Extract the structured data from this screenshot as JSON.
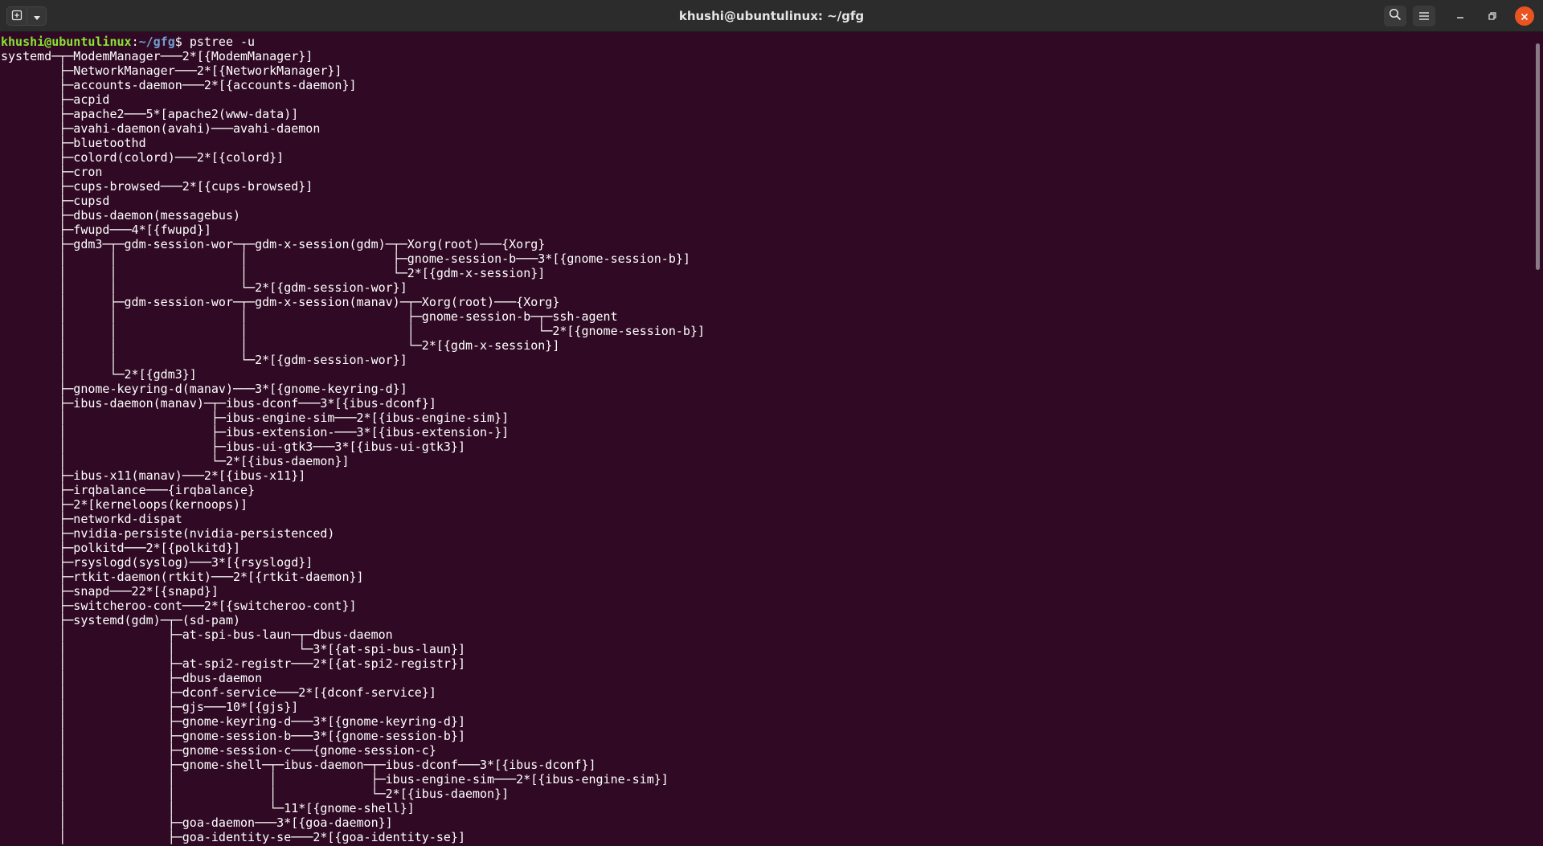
{
  "window": {
    "title": "khushi@ubuntulinux: ~/gfg"
  },
  "icons": {
    "new_tab": "new-tab-icon",
    "tab_menu": "chevron-down-icon",
    "search": "search-icon",
    "menu": "hamburger-menu-icon",
    "minimize": "minimize-icon",
    "maximize": "restore-icon",
    "close": "close-icon"
  },
  "colors": {
    "terminal_bg": "#300a24",
    "prompt_user": "#8ae234",
    "prompt_path": "#729fcf",
    "close_button": "#e95420"
  },
  "terminal": {
    "prompt_user": "khushi@ubuntulinux",
    "prompt_sep": ":",
    "prompt_path": "~/gfg",
    "prompt_end": "$ ",
    "command": "pstree -u",
    "output": "systemd─┬─ModemManager───2*[{ModemManager}]\n        ├─NetworkManager───2*[{NetworkManager}]\n        ├─accounts-daemon───2*[{accounts-daemon}]\n        ├─acpid\n        ├─apache2───5*[apache2(www-data)]\n        ├─avahi-daemon(avahi)───avahi-daemon\n        ├─bluetoothd\n        ├─colord(colord)───2*[{colord}]\n        ├─cron\n        ├─cups-browsed───2*[{cups-browsed}]\n        ├─cupsd\n        ├─dbus-daemon(messagebus)\n        ├─fwupd───4*[{fwupd}]\n        ├─gdm3─┬─gdm-session-wor─┬─gdm-x-session(gdm)─┬─Xorg(root)───{Xorg}\n        │      │                 │                    ├─gnome-session-b───3*[{gnome-session-b}]\n        │      │                 │                    └─2*[{gdm-x-session}]\n        │      │                 └─2*[{gdm-session-wor}]\n        │      ├─gdm-session-wor─┬─gdm-x-session(manav)─┬─Xorg(root)───{Xorg}\n        │      │                 │                      ├─gnome-session-b─┬─ssh-agent\n        │      │                 │                      │                 └─2*[{gnome-session-b}]\n        │      │                 │                      └─2*[{gdm-x-session}]\n        │      │                 └─2*[{gdm-session-wor}]\n        │      └─2*[{gdm3}]\n        ├─gnome-keyring-d(manav)───3*[{gnome-keyring-d}]\n        ├─ibus-daemon(manav)─┬─ibus-dconf───3*[{ibus-dconf}]\n        │                    ├─ibus-engine-sim───2*[{ibus-engine-sim}]\n        │                    ├─ibus-extension-───3*[{ibus-extension-}]\n        │                    ├─ibus-ui-gtk3───3*[{ibus-ui-gtk3}]\n        │                    └─2*[{ibus-daemon}]\n        ├─ibus-x11(manav)───2*[{ibus-x11}]\n        ├─irqbalance───{irqbalance}\n        ├─2*[kerneloops(kernoops)]\n        ├─networkd-dispat\n        ├─nvidia-persiste(nvidia-persistenced)\n        ├─polkitd───2*[{polkitd}]\n        ├─rsyslogd(syslog)───3*[{rsyslogd}]\n        ├─rtkit-daemon(rtkit)───2*[{rtkit-daemon}]\n        ├─snapd───22*[{snapd}]\n        ├─switcheroo-cont───2*[{switcheroo-cont}]\n        ├─systemd(gdm)─┬─(sd-pam)\n        │              ├─at-spi-bus-laun─┬─dbus-daemon\n        │              │                 └─3*[{at-spi-bus-laun}]\n        │              ├─at-spi2-registr───2*[{at-spi2-registr}]\n        │              ├─dbus-daemon\n        │              ├─dconf-service───2*[{dconf-service}]\n        │              ├─gjs───10*[{gjs}]\n        │              ├─gnome-keyring-d───3*[{gnome-keyring-d}]\n        │              ├─gnome-session-b───3*[{gnome-session-b}]\n        │              ├─gnome-session-c───{gnome-session-c}\n        │              ├─gnome-shell─┬─ibus-daemon─┬─ibus-dconf───3*[{ibus-dconf}]\n        │              │             │             ├─ibus-engine-sim───2*[{ibus-engine-sim}]\n        │              │             │             └─2*[{ibus-daemon}]\n        │              │             └─11*[{gnome-shell}]\n        │              ├─goa-daemon───3*[{goa-daemon}]\n        │              ├─goa-identity-se───2*[{goa-identity-se}]"
  }
}
